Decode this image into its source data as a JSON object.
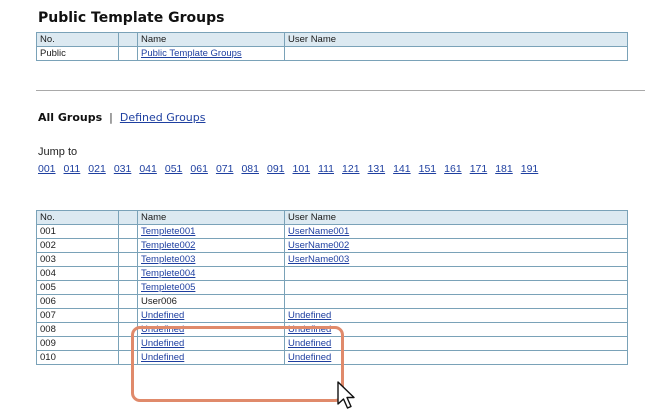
{
  "public_section": {
    "title": "Public Template Groups",
    "headers": {
      "no": "No.",
      "name": "Name",
      "user": "User Name"
    },
    "row": {
      "no": "Public",
      "name": "Public Template Groups",
      "user": ""
    }
  },
  "tabs": {
    "all": "All Groups",
    "separator": "|",
    "defined": "Defined Groups "
  },
  "jump": {
    "label": "Jump to",
    "links": [
      "001",
      "011",
      "021",
      "031",
      "041",
      "051",
      "061",
      "071",
      "081",
      "091",
      "101",
      "111",
      "121",
      "131",
      "141",
      "151",
      "161",
      "171",
      "181",
      "191"
    ]
  },
  "groups_table": {
    "headers": {
      "no": "No.",
      "name": "Name",
      "user": "User Name"
    },
    "rows": [
      {
        "no": "001",
        "name": "Templete001",
        "user": "UserName001"
      },
      {
        "no": "002",
        "name": "Templete002",
        "user": "UserName002"
      },
      {
        "no": "003",
        "name": "Templete003",
        "user": "UserName003"
      },
      {
        "no": "004",
        "name": "Templete004",
        "user": ""
      },
      {
        "no": "005",
        "name": "Templete005",
        "user": ""
      },
      {
        "no": "006",
        "name": "User006",
        "user": ""
      },
      {
        "no": "007",
        "name": "Undefined",
        "user": "Undefined"
      },
      {
        "no": "008",
        "name": "Undefined",
        "user": "Undefined"
      },
      {
        "no": "009",
        "name": "Undefined",
        "user": "Undefined"
      },
      {
        "no": "010",
        "name": "Undefined",
        "user": "Undefined"
      }
    ]
  },
  "colors": {
    "header_bg": "#dce9f1",
    "border": "#7aa2b8",
    "link": "#1e3fa0",
    "highlight": "#e08a6b"
  },
  "icons": {
    "cursor": "arrow-cursor-icon"
  }
}
